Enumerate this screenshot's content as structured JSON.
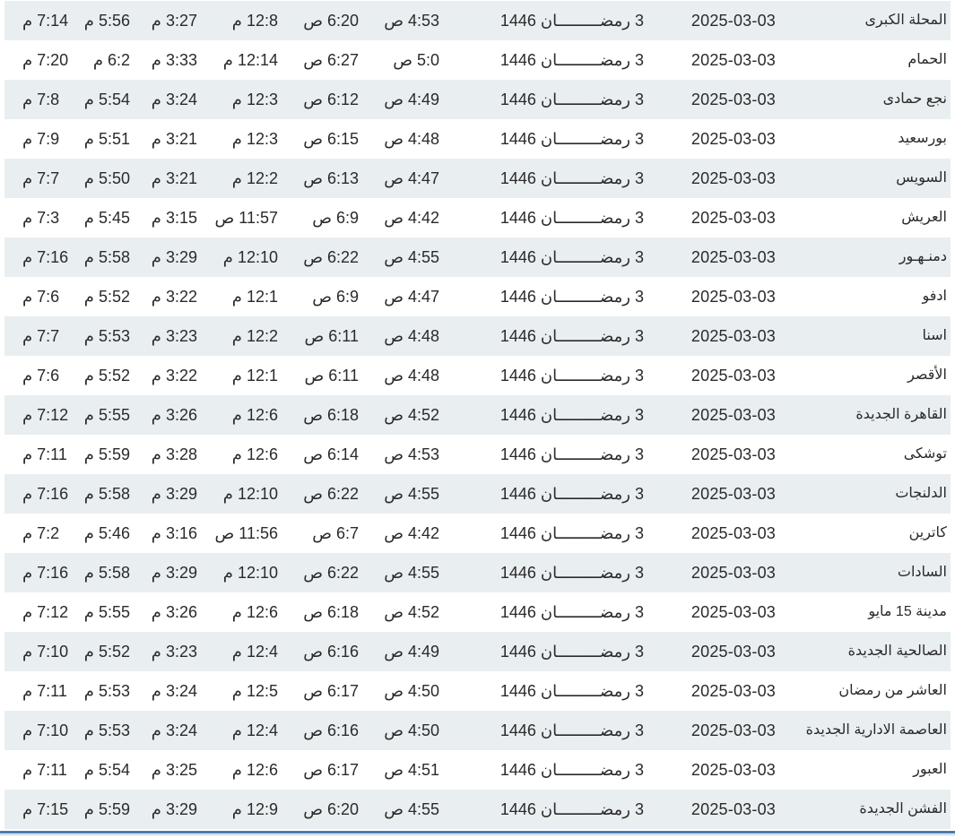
{
  "table": {
    "rows": [
      {
        "city": "المحلة الكبرى",
        "gregorian": "2025-03-03",
        "hijri": "3 رمضـــــــــان 1446",
        "fajr": "4:53 ص",
        "sunrise": "6:20 ص",
        "dhuhr": "12:8 م",
        "asr": "3:27 م",
        "maghrib": "5:56 م",
        "isha": "7:14 م"
      },
      {
        "city": "الحمام",
        "gregorian": "2025-03-03",
        "hijri": "3 رمضـــــــــان 1446",
        "fajr": "5:0 ص",
        "sunrise": "6:27 ص",
        "dhuhr": "12:14 م",
        "asr": "3:33 م",
        "maghrib": "6:2 م",
        "isha": "7:20 م"
      },
      {
        "city": "نجع حمادى",
        "gregorian": "2025-03-03",
        "hijri": "3 رمضـــــــــان 1446",
        "fajr": "4:49 ص",
        "sunrise": "6:12 ص",
        "dhuhr": "12:3 م",
        "asr": "3:24 م",
        "maghrib": "5:54 م",
        "isha": "7:8 م"
      },
      {
        "city": "بورسعيد",
        "gregorian": "2025-03-03",
        "hijri": "3 رمضـــــــــان 1446",
        "fajr": "4:48 ص",
        "sunrise": "6:15 ص",
        "dhuhr": "12:3 م",
        "asr": "3:21 م",
        "maghrib": "5:51 م",
        "isha": "7:9 م"
      },
      {
        "city": "السويس",
        "gregorian": "2025-03-03",
        "hijri": "3 رمضـــــــــان 1446",
        "fajr": "4:47 ص",
        "sunrise": "6:13 ص",
        "dhuhr": "12:2 م",
        "asr": "3:21 م",
        "maghrib": "5:50 م",
        "isha": "7:7 م"
      },
      {
        "city": "العريش",
        "gregorian": "2025-03-03",
        "hijri": "3 رمضـــــــــان 1446",
        "fajr": "4:42 ص",
        "sunrise": "6:9 ص",
        "dhuhr": "11:57 ص",
        "asr": "3:15 م",
        "maghrib": "5:45 م",
        "isha": "7:3 م"
      },
      {
        "city": "دمنـهـور",
        "gregorian": "2025-03-03",
        "hijri": "3 رمضـــــــــان 1446",
        "fajr": "4:55 ص",
        "sunrise": "6:22 ص",
        "dhuhr": "12:10 م",
        "asr": "3:29 م",
        "maghrib": "5:58 م",
        "isha": "7:16 م"
      },
      {
        "city": "ادفو",
        "gregorian": "2025-03-03",
        "hijri": "3 رمضـــــــــان 1446",
        "fajr": "4:47 ص",
        "sunrise": "6:9 ص",
        "dhuhr": "12:1 م",
        "asr": "3:22 م",
        "maghrib": "5:52 م",
        "isha": "7:6 م"
      },
      {
        "city": "اسنا",
        "gregorian": "2025-03-03",
        "hijri": "3 رمضـــــــــان 1446",
        "fajr": "4:48 ص",
        "sunrise": "6:11 ص",
        "dhuhr": "12:2 م",
        "asr": "3:23 م",
        "maghrib": "5:53 م",
        "isha": "7:7 م"
      },
      {
        "city": "الأقصر",
        "gregorian": "2025-03-03",
        "hijri": "3 رمضـــــــــان 1446",
        "fajr": "4:48 ص",
        "sunrise": "6:11 ص",
        "dhuhr": "12:1 م",
        "asr": "3:22 م",
        "maghrib": "5:52 م",
        "isha": "7:6 م"
      },
      {
        "city": "القاهرة الجديدة",
        "gregorian": "2025-03-03",
        "hijri": "3 رمضـــــــــان 1446",
        "fajr": "4:52 ص",
        "sunrise": "6:18 ص",
        "dhuhr": "12:6 م",
        "asr": "3:26 م",
        "maghrib": "5:55 م",
        "isha": "7:12 م"
      },
      {
        "city": "توشكى",
        "gregorian": "2025-03-03",
        "hijri": "3 رمضـــــــــان 1446",
        "fajr": "4:53 ص",
        "sunrise": "6:14 ص",
        "dhuhr": "12:6 م",
        "asr": "3:28 م",
        "maghrib": "5:59 م",
        "isha": "7:11 م"
      },
      {
        "city": "الدلنجات",
        "gregorian": "2025-03-03",
        "hijri": "3 رمضـــــــــان 1446",
        "fajr": "4:55 ص",
        "sunrise": "6:22 ص",
        "dhuhr": "12:10 م",
        "asr": "3:29 م",
        "maghrib": "5:58 م",
        "isha": "7:16 م"
      },
      {
        "city": "كاترين",
        "gregorian": "2025-03-03",
        "hijri": "3 رمضـــــــــان 1446",
        "fajr": "4:42 ص",
        "sunrise": "6:7 ص",
        "dhuhr": "11:56 ص",
        "asr": "3:16 م",
        "maghrib": "5:46 م",
        "isha": "7:2 م"
      },
      {
        "city": "السادات",
        "gregorian": "2025-03-03",
        "hijri": "3 رمضـــــــــان 1446",
        "fajr": "4:55 ص",
        "sunrise": "6:22 ص",
        "dhuhr": "12:10 م",
        "asr": "3:29 م",
        "maghrib": "5:58 م",
        "isha": "7:16 م"
      },
      {
        "city": "مدينة 15 مايو",
        "gregorian": "2025-03-03",
        "hijri": "3 رمضـــــــــان 1446",
        "fajr": "4:52 ص",
        "sunrise": "6:18 ص",
        "dhuhr": "12:6 م",
        "asr": "3:26 م",
        "maghrib": "5:55 م",
        "isha": "7:12 م"
      },
      {
        "city": "الصالحية الجديدة",
        "gregorian": "2025-03-03",
        "hijri": "3 رمضـــــــــان 1446",
        "fajr": "4:49 ص",
        "sunrise": "6:16 ص",
        "dhuhr": "12:4 م",
        "asr": "3:23 م",
        "maghrib": "5:52 م",
        "isha": "7:10 م"
      },
      {
        "city": "العاشر من رمضان",
        "gregorian": "2025-03-03",
        "hijri": "3 رمضـــــــــان 1446",
        "fajr": "4:50 ص",
        "sunrise": "6:17 ص",
        "dhuhr": "12:5 م",
        "asr": "3:24 م",
        "maghrib": "5:53 م",
        "isha": "7:11 م"
      },
      {
        "city": "العاصمة الادارية الجديدة",
        "gregorian": "2025-03-03",
        "hijri": "3 رمضـــــــــان 1446",
        "fajr": "4:50 ص",
        "sunrise": "6:16 ص",
        "dhuhr": "12:4 م",
        "asr": "3:24 م",
        "maghrib": "5:53 م",
        "isha": "7:10 م"
      },
      {
        "city": "العبور",
        "gregorian": "2025-03-03",
        "hijri": "3 رمضـــــــــان 1446",
        "fajr": "4:51 ص",
        "sunrise": "6:17 ص",
        "dhuhr": "12:6 م",
        "asr": "3:25 م",
        "maghrib": "5:54 م",
        "isha": "7:11 م"
      },
      {
        "city": "الفشن الجديدة",
        "gregorian": "2025-03-03",
        "hijri": "3 رمضـــــــــان 1446",
        "fajr": "4:55 ص",
        "sunrise": "6:20 ص",
        "dhuhr": "12:9 م",
        "asr": "3:29 م",
        "maghrib": "5:59 م",
        "isha": "7:15 م"
      }
    ]
  }
}
